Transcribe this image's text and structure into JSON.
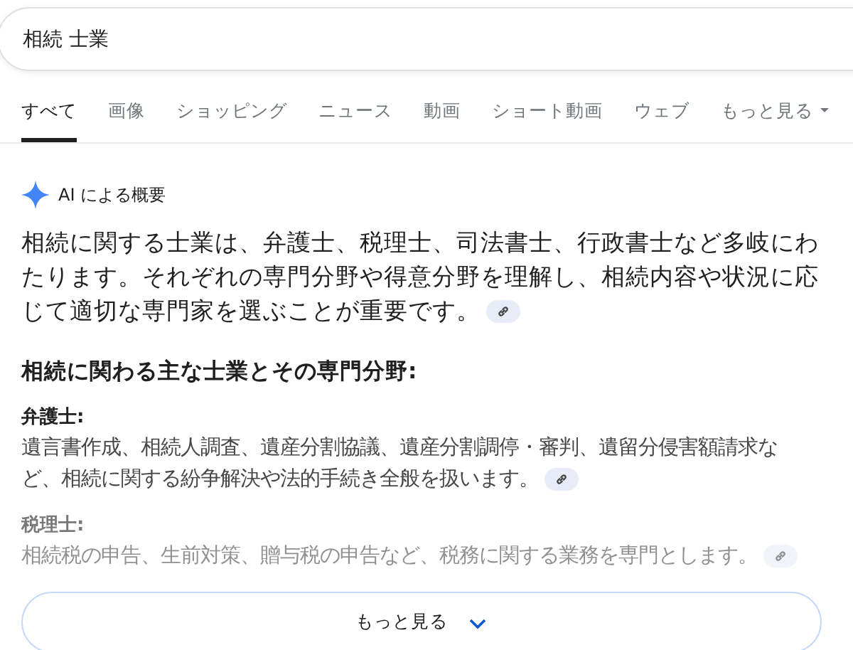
{
  "search": {
    "value": "相続 士業"
  },
  "tabs": [
    {
      "label": "すべて",
      "selected": true
    },
    {
      "label": "画像",
      "selected": false
    },
    {
      "label": "ショッピング",
      "selected": false
    },
    {
      "label": "ニュース",
      "selected": false
    },
    {
      "label": "動画",
      "selected": false
    },
    {
      "label": "ショート動画",
      "selected": false
    },
    {
      "label": "ウェブ",
      "selected": false
    },
    {
      "label": "もっと見る",
      "selected": false,
      "dropdown": true
    }
  ],
  "overview": {
    "title": "AI による概要",
    "summary": "相続に関する士業は、弁護士、税理士、司法書士、行政書士など多岐にわたります。それぞれの専門分野や得意分野を理解し、相続内容や状況に応じて適切な専門家を選ぶことが重要です。",
    "heading": "相続に関わる主な士業とその専門分野:",
    "items": [
      {
        "name": "弁護士:",
        "description": "遺言書作成、相続人調査、遺産分割協議、遺産分割調停・審判、遺留分侵害額請求など、相続に関する紛争解決や法的手続き全般を扱います。",
        "faded": false
      },
      {
        "name": "税理士:",
        "description": "相続税の申告、生前対策、贈与税の申告など、税務に関する業務を専門とします。",
        "faded": true
      }
    ],
    "more_button": "もっと見る"
  }
}
